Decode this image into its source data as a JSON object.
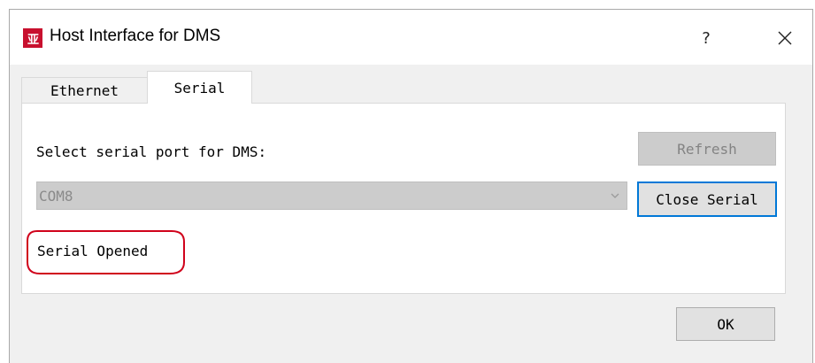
{
  "window": {
    "title": "Host Interface for DMS",
    "app_icon_glyph": "亚",
    "help_label": "?",
    "close_icon": "close-icon"
  },
  "tabs": [
    {
      "label": "Ethernet",
      "selected": false
    },
    {
      "label": "Serial",
      "selected": true
    }
  ],
  "serial_panel": {
    "prompt": "Select serial port for DMS:",
    "refresh_label": "Refresh",
    "refresh_enabled": false,
    "port_value": "COM8",
    "port_enabled": false,
    "toggle_label": "Close Serial",
    "status": "Serial Opened"
  },
  "footer": {
    "ok_label": "OK"
  },
  "colors": {
    "accent": "#0078d7",
    "annotation": "#d0021b",
    "app_icon": "#c8102e"
  }
}
